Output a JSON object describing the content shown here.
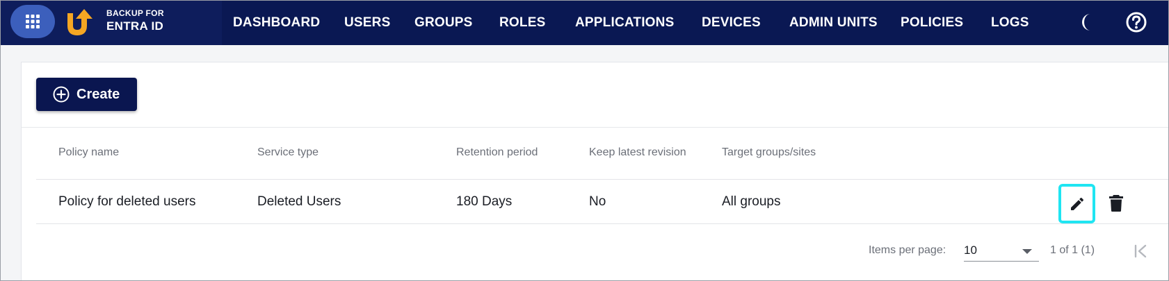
{
  "brand": {
    "line1": "BACKUP FOR",
    "line2": "ENTRA ID"
  },
  "nav": {
    "items": [
      "DASHBOARD",
      "USERS",
      "GROUPS",
      "ROLES",
      "APPLICATIONS",
      "DEVICES",
      "ADMIN UNITS",
      "POLICIES",
      "LOGS"
    ]
  },
  "toolbar": {
    "create_label": "Create"
  },
  "table": {
    "columns": [
      "Policy name",
      "Service type",
      "Retention period",
      "Keep latest revision",
      "Target groups/sites"
    ],
    "rows": [
      [
        "Policy for deleted users",
        "Deleted Users",
        "180 Days",
        "No",
        "All groups"
      ]
    ]
  },
  "pagination": {
    "items_per_page_label": "Items per page:",
    "items_per_page_value": "10",
    "range_label": "1 of 1 (1)"
  },
  "icons": {
    "app_grid": "apps-grid-icon",
    "logo": "backup-logo-icon",
    "theme": "moon-icon",
    "help": "help-icon",
    "create": "plus-circle-icon",
    "edit": "pencil-icon",
    "delete": "trash-icon",
    "first_page": "first-page-icon"
  },
  "colors": {
    "nav_background": "#0a1853",
    "accent_button": "#0a1650",
    "app_grid_button": "#3c5fbc",
    "logo_orange": "#f5a623",
    "edit_highlight": "#1fe5f2"
  }
}
